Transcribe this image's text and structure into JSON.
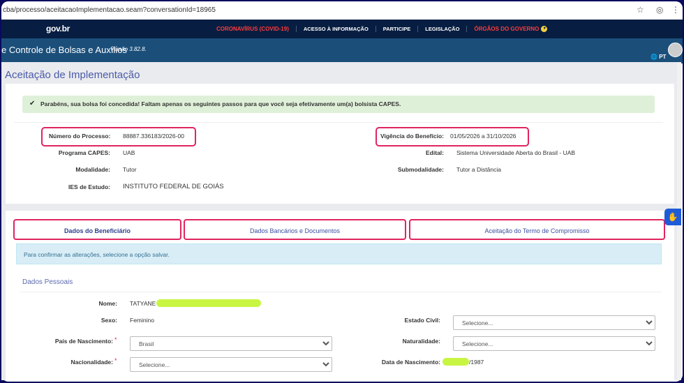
{
  "browser": {
    "url": "cba/processo/aceitacaoImplementacao.seam?conversationId=18965",
    "star_icon": "star-icon",
    "profile_icon": "profile-icon",
    "menu_icon": "kebab-menu-icon"
  },
  "govbar": {
    "logo": "gov.br",
    "links": [
      "CORONAVÍRUS (COVID-19)",
      "ACESSO À INFORMAÇÃO",
      "PARTICIPE",
      "LEGISLAÇÃO",
      "ÓRGÃOS DO GOVERNO"
    ]
  },
  "app": {
    "title": "e Controle de Bolsas e Auxílios",
    "version": "Versão 3.82.8.",
    "language": "PT"
  },
  "page": {
    "title": "Aceitação de Implementação",
    "success_message": "Parabéns, sua bolsa foi concedida! Faltam apenas os seguintes passos para que você seja efetivamente um(a) bolsista CAPES."
  },
  "process": {
    "numero_label": "Número do Processo:",
    "numero_value": "88887.336183/2026-00",
    "programa_label": "Programa CAPES:",
    "programa_value": "UAB",
    "modalidade_label": "Modalidade:",
    "modalidade_value": "Tutor",
    "ies_label": "IES de Estudo:",
    "ies_value": "INSTITUTO FEDERAL DE GOIÁS",
    "vigencia_label": "Vigência do Benefício:",
    "vigencia_value": "01/05/2026 a 31/10/2026",
    "edital_label": "Edital:",
    "edital_value": "Sistema Universidade Aberta do Brasil - UAB",
    "submodalidade_label": "Submodalidade:",
    "submodalidade_value": "Tutor a Distância"
  },
  "tabs": [
    "Dados do Beneficiário",
    "Dados Bancários e Documentos",
    "Aceitação do Termo de Compromisso"
  ],
  "info_message": "Para confirmar as alterações, selecione a opção salvar.",
  "section_title": "Dados Pessoais",
  "form": {
    "nome_label": "Nome:",
    "nome_value": "TATYANE I",
    "sexo_label": "Sexo:",
    "sexo_value": "Feminino",
    "pais_label": "País de Nascimento:",
    "pais_value": "Brasil",
    "nacionalidade_label": "Nacionalidade:",
    "nacionalidade_value": "Selecione...",
    "estado_civil_label": "Estado Civil:",
    "estado_civil_value": "Selecione...",
    "naturalidade_label": "Naturalidade:",
    "naturalidade_value": "Selecione...",
    "data_nasc_label": "Data de Nascimento:",
    "data_nasc_value": "/1987",
    "required_mark": "*"
  },
  "colors": {
    "gov_bar": "#071d41",
    "app_header": "#1b4f7a",
    "highlight": "#e0245e",
    "redaction": "#c8f542"
  }
}
